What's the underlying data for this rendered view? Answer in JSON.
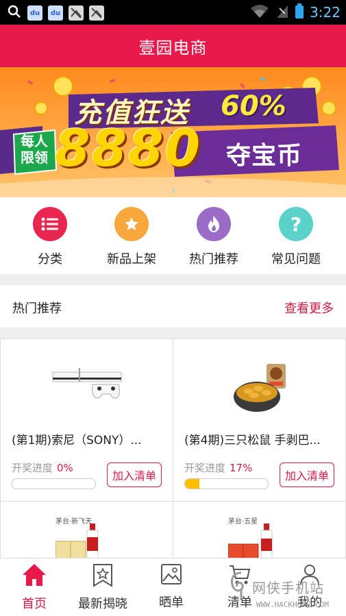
{
  "status_bar": {
    "time": "3:22",
    "icons": [
      "search-icon",
      "baidu-icon",
      "baidu-icon",
      "no-signal-icon",
      "no-signal-icon"
    ]
  },
  "header": {
    "title": "壹园电商"
  },
  "banner": {
    "line1": "充值狂送",
    "percent": "60%",
    "badge_top": "每人",
    "badge_bottom": "限领",
    "amount": "8880",
    "unit": "夺宝币"
  },
  "quick_nav": [
    {
      "label": "分类",
      "icon": "list-icon",
      "color": "#e8264e"
    },
    {
      "label": "新品上架",
      "icon": "star-icon",
      "color": "#f7a73b"
    },
    {
      "label": "热门推荐",
      "icon": "flame-icon",
      "color": "#9b6bc8"
    },
    {
      "label": "常见问题",
      "icon": "question-icon",
      "color": "#5ad1c9"
    }
  ],
  "hot": {
    "title": "热门推荐",
    "more": "查看更多"
  },
  "products": [
    {
      "name": "(第1期)索尼（SONY）...",
      "progress_label": "开奖进度",
      "progress_text": "0%",
      "progress": 0,
      "button": "加入清单"
    },
    {
      "name": "(第4期)三只松鼠 手剥巴...",
      "progress_label": "开奖进度",
      "progress_text": "17%",
      "progress": 0.17,
      "button": "加入清单"
    },
    {
      "image_caption": "茅台·新飞天"
    },
    {
      "image_caption": "茅台·五星"
    }
  ],
  "bottom_nav": [
    {
      "label": "首页",
      "icon": "home-icon",
      "active": true
    },
    {
      "label": "最新揭晓",
      "icon": "ribbon-star-icon",
      "active": false
    },
    {
      "label": "晒单",
      "icon": "image-icon",
      "active": false
    },
    {
      "label": "清单",
      "icon": "cart-icon",
      "active": false
    },
    {
      "label": "我的",
      "icon": "user-icon",
      "active": false
    }
  ],
  "watermark": {
    "text": "网侠手机站",
    "url": "WWW.HACKHOME.COM"
  },
  "colors": {
    "brand": "#e8194b",
    "accent": "#d81a46",
    "progress_fill": "#ffbf00"
  }
}
